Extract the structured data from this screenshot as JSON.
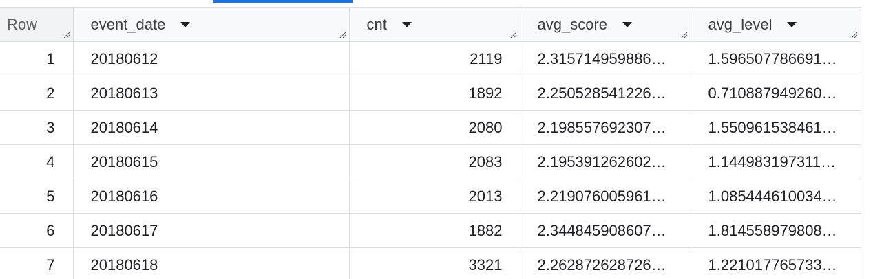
{
  "table": {
    "columns": [
      {
        "key": "row",
        "label": "Row"
      },
      {
        "key": "event_date",
        "label": "event_date"
      },
      {
        "key": "cnt",
        "label": "cnt"
      },
      {
        "key": "avg_score",
        "label": "avg_score"
      },
      {
        "key": "avg_level",
        "label": "avg_level"
      }
    ],
    "rows": [
      {
        "row": "1",
        "event_date": "20180612",
        "cnt": "2119",
        "avg_score": "2.315714959886…",
        "avg_level": "1.596507786691…"
      },
      {
        "row": "2",
        "event_date": "20180613",
        "cnt": "1892",
        "avg_score": "2.250528541226…",
        "avg_level": "0.710887949260…"
      },
      {
        "row": "3",
        "event_date": "20180614",
        "cnt": "2080",
        "avg_score": "2.198557692307…",
        "avg_level": "1.550961538461…"
      },
      {
        "row": "4",
        "event_date": "20180615",
        "cnt": "2083",
        "avg_score": "2.195391262602…",
        "avg_level": "1.144983197311…"
      },
      {
        "row": "5",
        "event_date": "20180616",
        "cnt": "2013",
        "avg_score": "2.219076005961…",
        "avg_level": "1.085444610034…"
      },
      {
        "row": "6",
        "event_date": "20180617",
        "cnt": "1882",
        "avg_score": "2.344845908607…",
        "avg_level": "1.814558979808…"
      },
      {
        "row": "7",
        "event_date": "20180618",
        "cnt": "3321",
        "avg_score": "2.262872628726…",
        "avg_level": "1.221017765733…"
      }
    ]
  },
  "icons": {
    "sort": "caret-down-icon",
    "resize": "column-resize-handle-icon"
  },
  "colors": {
    "accent": "#1a73e8",
    "header_bg": "#f8f9fa",
    "grid": "#dadce0",
    "text": "#202124"
  }
}
